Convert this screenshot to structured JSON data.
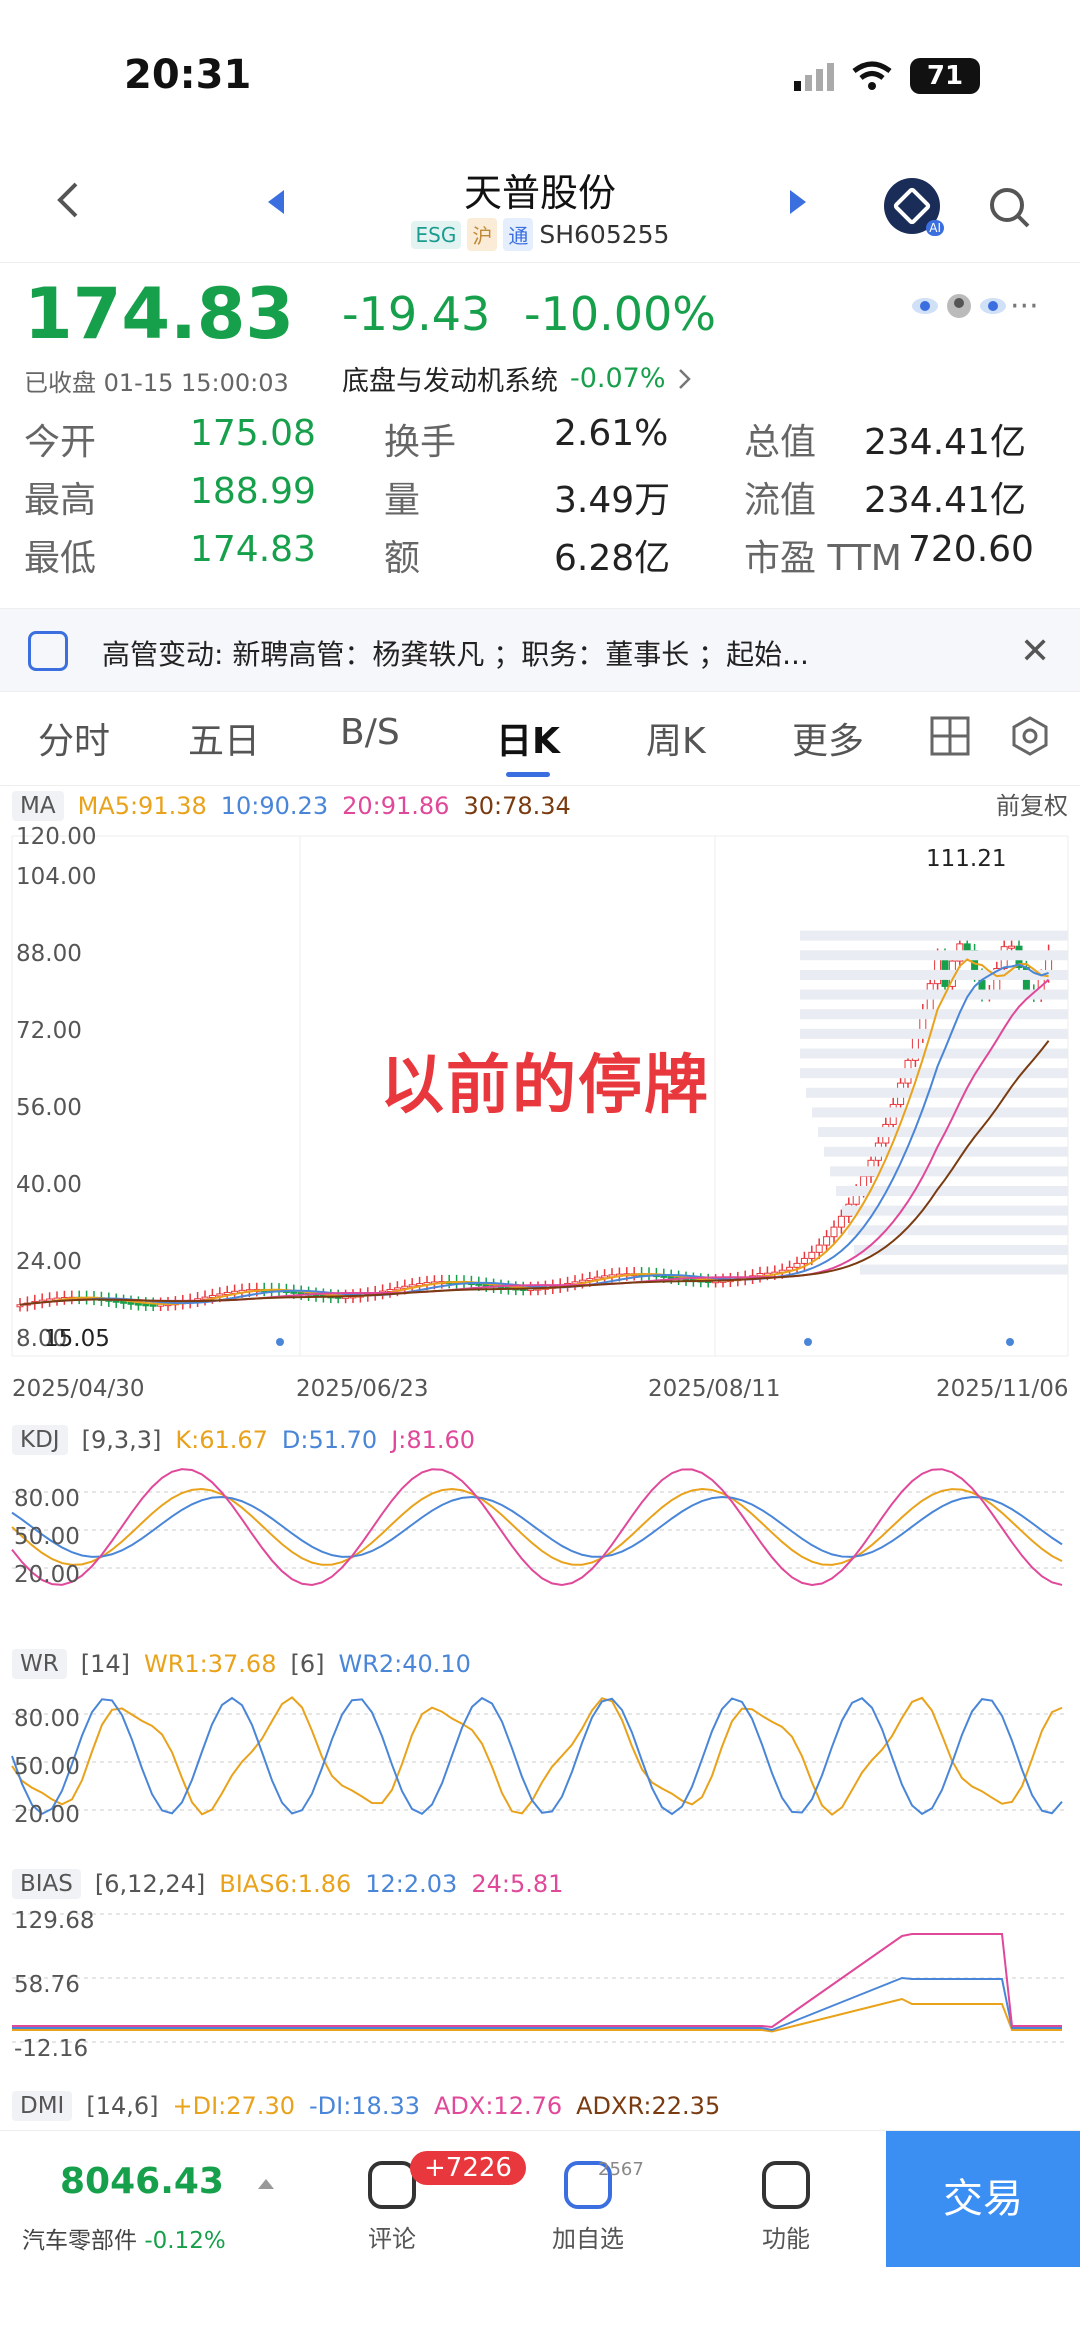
{
  "status_bar": {
    "time": "20:31",
    "battery": "71"
  },
  "nav": {
    "title": "天普股份",
    "tags": [
      "ESG",
      "沪",
      "通"
    ],
    "code": "SH605255",
    "ai_badge": "AI"
  },
  "quote": {
    "price": "174.83",
    "change": "-19.43",
    "change_pct": "-10.00%",
    "more": "···",
    "status": "已收盘 01-15 15:00:03",
    "sector_name": "底盘与发动机系统",
    "sector_pct": "-0.07%",
    "stats": [
      {
        "label": "今开",
        "value": "175.08",
        "label2": "换手",
        "value2": "2.61%",
        "label3": "总值",
        "value3": "234.41亿"
      },
      {
        "label": "最高",
        "value": "188.99",
        "label2": "量",
        "value2": "3.49万",
        "label3": "流值",
        "value3": "234.41亿"
      },
      {
        "label": "最低",
        "value": "174.83",
        "label2": "额",
        "value2": "6.28亿",
        "label3": "市盈 TTM",
        "value3": "720.60"
      }
    ]
  },
  "notice": {
    "text": "高管变动: 新聘高管：杨龚轶凡 ；职务：董事长 ；起始..."
  },
  "tabs": [
    "分时",
    "五日",
    "B/S",
    "日K",
    "周K",
    "更多"
  ],
  "active_tab": "日K",
  "kline": {
    "ma_label": "MA",
    "ma5": "MA5:91.38",
    "ma10": "10:90.23",
    "ma20": "20:91.86",
    "ma30": "30:78.34",
    "adjust": "前复权",
    "y_ticks": [
      "120.00",
      "104.00",
      "88.00",
      "72.00",
      "56.00",
      "40.00",
      "24.00",
      "8.00"
    ],
    "max_label": "111.21",
    "min_label": "15.05",
    "x_ticks": [
      "2025/04/30",
      "2025/06/23",
      "2025/08/11",
      "2025/11/06"
    ],
    "overlay": "以前的停牌",
    "colors": {
      "ma5": "#e9a21b",
      "ma10": "#4a86d8",
      "ma20": "#e0489a",
      "ma30": "#7a3b10",
      "up": "#e8373d",
      "down": "#17a04b"
    }
  },
  "kdj": {
    "label": "KDJ",
    "params": "[9,3,3]",
    "k": "K:61.67",
    "d": "D:51.70",
    "j": "J:81.60",
    "ticks": [
      "80.00",
      "50.00",
      "20.00"
    ]
  },
  "wr": {
    "label": "WR",
    "p1": "[14]",
    "wr1": "WR1:37.68",
    "p2": "[6]",
    "wr2": "WR2:40.10",
    "ticks": [
      "80.00",
      "50.00",
      "20.00"
    ]
  },
  "bias": {
    "label": "BIAS",
    "params": "[6,12,24]",
    "b6": "BIAS6:1.86",
    "b12": "12:2.03",
    "b24": "24:5.81",
    "ticks": [
      "129.68",
      "58.76",
      "-12.16"
    ]
  },
  "dmi": {
    "label": "DMI",
    "params": "[14,6]",
    "pdi": "+DI:27.30",
    "mdi": "-DI:18.33",
    "adx": "ADX:12.76",
    "adxr": "ADXR:22.35"
  },
  "bottom": {
    "index_value": "8046.43",
    "index_name": "汽车零部件",
    "index_pct": "-0.12%",
    "comment_label": "评论",
    "comment_badge": "+7226",
    "watch_label": "加自选",
    "watch_count": "2567",
    "func_label": "功能",
    "trade_label": "交易"
  }
}
